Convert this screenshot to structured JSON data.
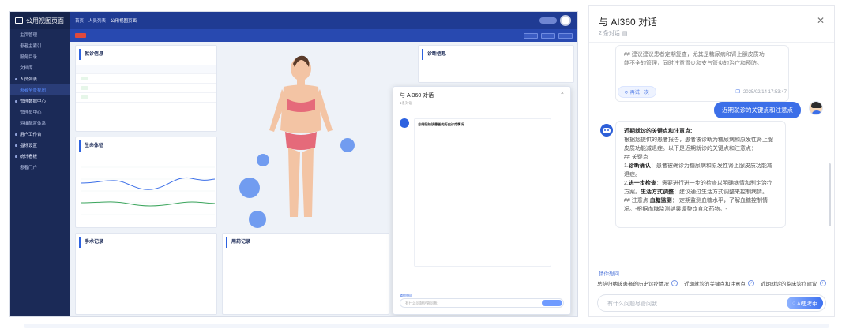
{
  "dashboard": {
    "brand": "公用视图页面",
    "tabs": [
      "首页",
      "人员列表",
      "公用视图页面"
    ],
    "sidebar": [
      {
        "label": "主页管理",
        "group": false
      },
      {
        "label": "患者主索引",
        "group": false
      },
      {
        "label": "服务目录",
        "group": false
      },
      {
        "label": "文档库",
        "group": false
      },
      {
        "label": "人员列表",
        "group": true
      },
      {
        "label": "患者全景视图",
        "group": false,
        "active": true
      },
      {
        "label": "管理数据中心",
        "group": true
      },
      {
        "label": "管理员中心",
        "group": false
      },
      {
        "label": "运维配置体系",
        "group": false
      },
      {
        "label": "用户工作台",
        "group": true
      },
      {
        "label": "指标设置",
        "group": true
      },
      {
        "label": "统计看板",
        "group": true
      },
      {
        "label": "患者门户",
        "group": false
      }
    ],
    "panels": {
      "visit": "就诊信息",
      "vitals": "生命体征",
      "surgery": "手术记录",
      "meds": "用药记录",
      "diag": "诊断信息"
    },
    "mini_dialog": {
      "title": "与 AI360 对话",
      "subtitle": "1条对话",
      "heading": "总结归纳该患者的历史诊疗情况",
      "suggest_label": "猜你想问",
      "input_placeholder": "有什么问题尽管问我",
      "send": "AI思考中"
    }
  },
  "chat": {
    "title": "与 AI360 对话",
    "subtitle": "2 条对话",
    "close_icon": "close-icon",
    "prev_card": {
      "line1": "## 建议建议患者定期复查，尤其是糖尿病和肾上腺皮质功",
      "line2": "能不全的管理，同时注意胃炎和支气管炎的治疗和预防。"
    },
    "retry": "再试一次",
    "timestamp": "2025/02/14 17:53:47",
    "user_message": "近期就诊的关键点和注意点",
    "answer": {
      "title": "近期就诊的关键点和注意点:",
      "p1": "根据您提供的患者报告，患者被诊断为糖尿病和原发性肾上腺皮质功能减退症。以下是近期就诊的关键点和注意点：",
      "p2": "## 关键点",
      "p3a": "1.",
      "p3b": "诊断确认",
      "p3c": "：患者被确诊为糖尿病和原发性肾上腺皮质功能减退症。",
      "p4a": "2.",
      "p4b": "进一步检查",
      "p4c": "：需要进行进一步的检查以明确病情和制定治疗方案。",
      "p4d": "生活方式调整",
      "p4e": "：建议通过生活方式调整来控制病情。",
      "p5a": "## 注意点",
      "p5b": "血糖监测",
      "p5c": "：-定期监测血糖水平，了解血糖控制情况。-根据血糖监测结果调整饮食和药物。-"
    },
    "suggest_label": "猜你想问",
    "suggestions": [
      "总结归纳该患者的历史诊疗情况",
      "近期就诊的关键点和注意点",
      "近期就诊的临床诊疗建议"
    ],
    "input_placeholder": "有什么问题尽管问我",
    "send_label": "AI思考中"
  },
  "colors": {
    "primary": "#3c6fe8",
    "sidebar": "#1b2a57",
    "topbar": "#1f3b93"
  }
}
